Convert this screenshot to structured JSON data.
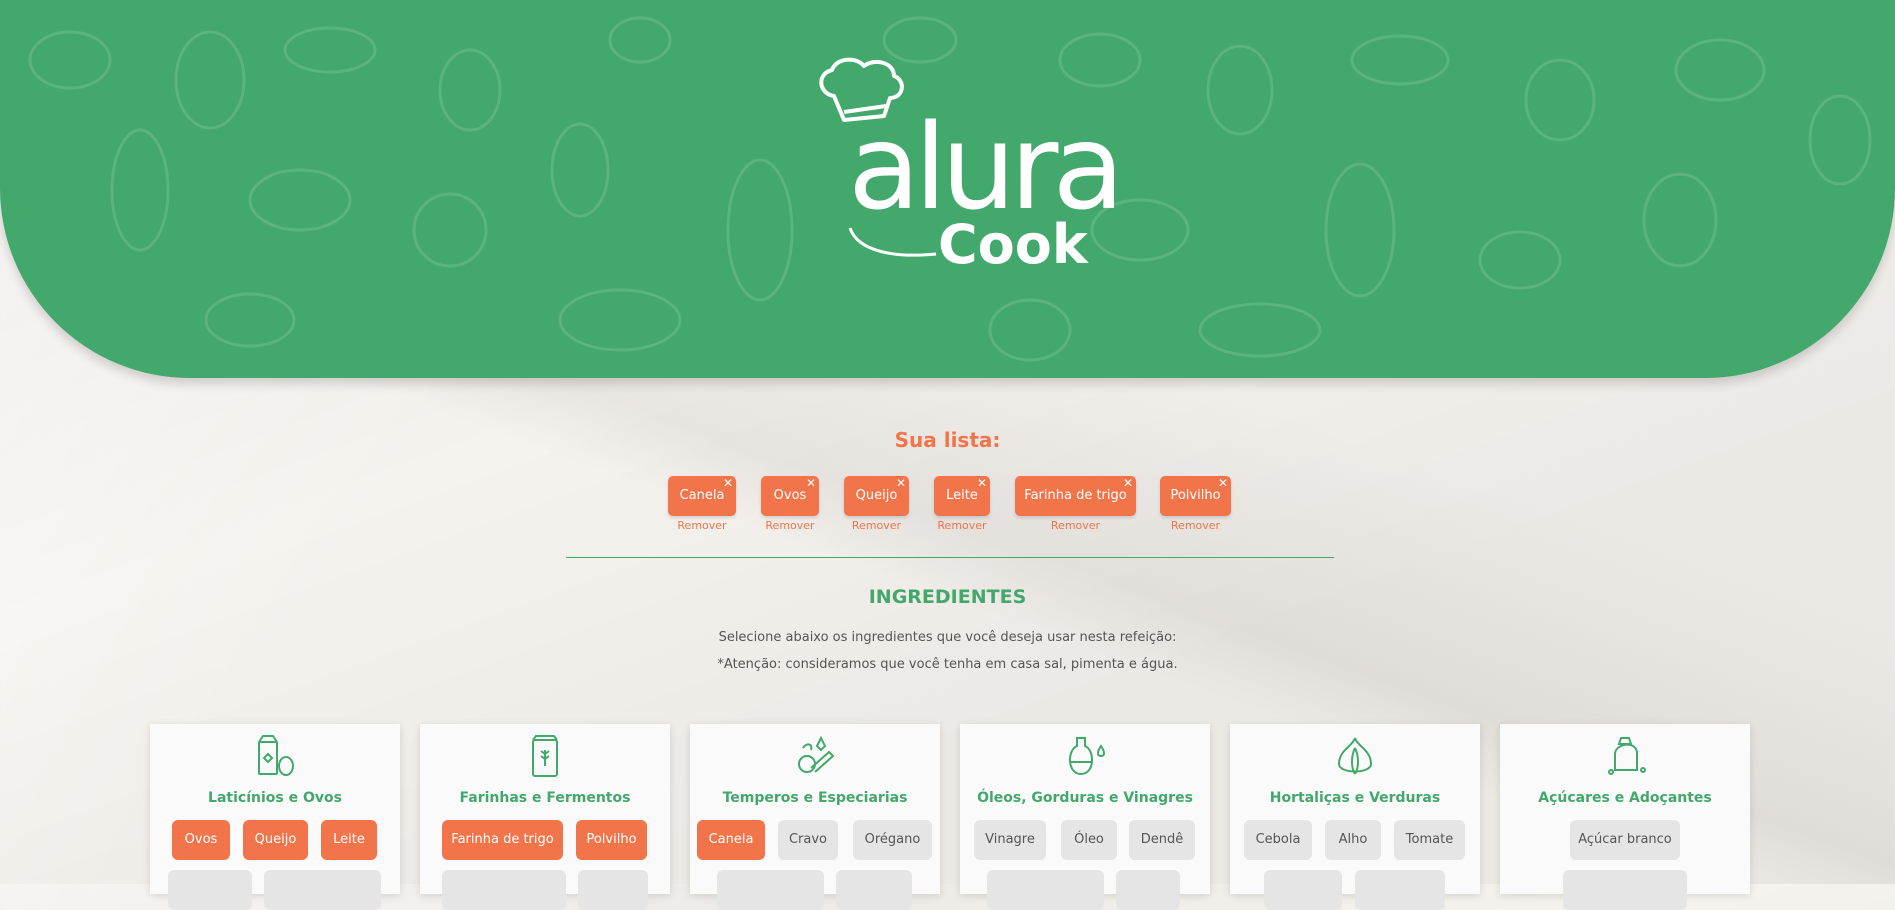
{
  "logo": {
    "alura": "alura",
    "cook": "Cook"
  },
  "list": {
    "title": "Sua lista:",
    "remove_label": "Remover",
    "items": [
      "Canela",
      "Ovos",
      "Queijo",
      "Leite",
      "Farinha de trigo",
      "Polvilho"
    ]
  },
  "ingredients": {
    "title": "INGREDIENTES",
    "description": "Selecione abaixo os ingredientes que você deseja usar nesta refeição:",
    "note": "*Atenção: consideramos que você tenha em casa sal, pimenta e água."
  },
  "categories": [
    {
      "title": "Laticínios e Ovos",
      "icon": "dairy-icon",
      "tags": [
        {
          "label": "Ovos",
          "selected": true
        },
        {
          "label": "Queijo",
          "selected": true
        },
        {
          "label": "Leite",
          "selected": true
        }
      ]
    },
    {
      "title": "Farinhas e Fermentos",
      "icon": "flour-icon",
      "tags": [
        {
          "label": "Farinha de trigo",
          "selected": true
        },
        {
          "label": "Polvilho",
          "selected": true
        }
      ]
    },
    {
      "title": "Temperos e Especiarias",
      "icon": "spices-icon",
      "tags": [
        {
          "label": "Canela",
          "selected": true
        },
        {
          "label": "Cravo",
          "selected": false
        },
        {
          "label": "Orégano",
          "selected": false
        }
      ]
    },
    {
      "title": "Óleos, Gorduras e Vinagres",
      "icon": "oil-icon",
      "tags": [
        {
          "label": "Vinagre",
          "selected": false
        },
        {
          "label": "Óleo",
          "selected": false
        },
        {
          "label": "Dendê",
          "selected": false
        }
      ]
    },
    {
      "title": "Hortaliças e Verduras",
      "icon": "garlic-icon",
      "tags": [
        {
          "label": "Cebola",
          "selected": false
        },
        {
          "label": "Alho",
          "selected": false
        },
        {
          "label": "Tomate",
          "selected": false
        }
      ]
    },
    {
      "title": "Açúcares e Adoçantes",
      "icon": "sugar-icon",
      "tags": [
        {
          "label": "Açúcar branco",
          "selected": false
        }
      ]
    }
  ],
  "colors": {
    "brand_green": "#43a86b",
    "accent_orange": "#f2744a",
    "tag_inactive": "#e5e5e5"
  }
}
